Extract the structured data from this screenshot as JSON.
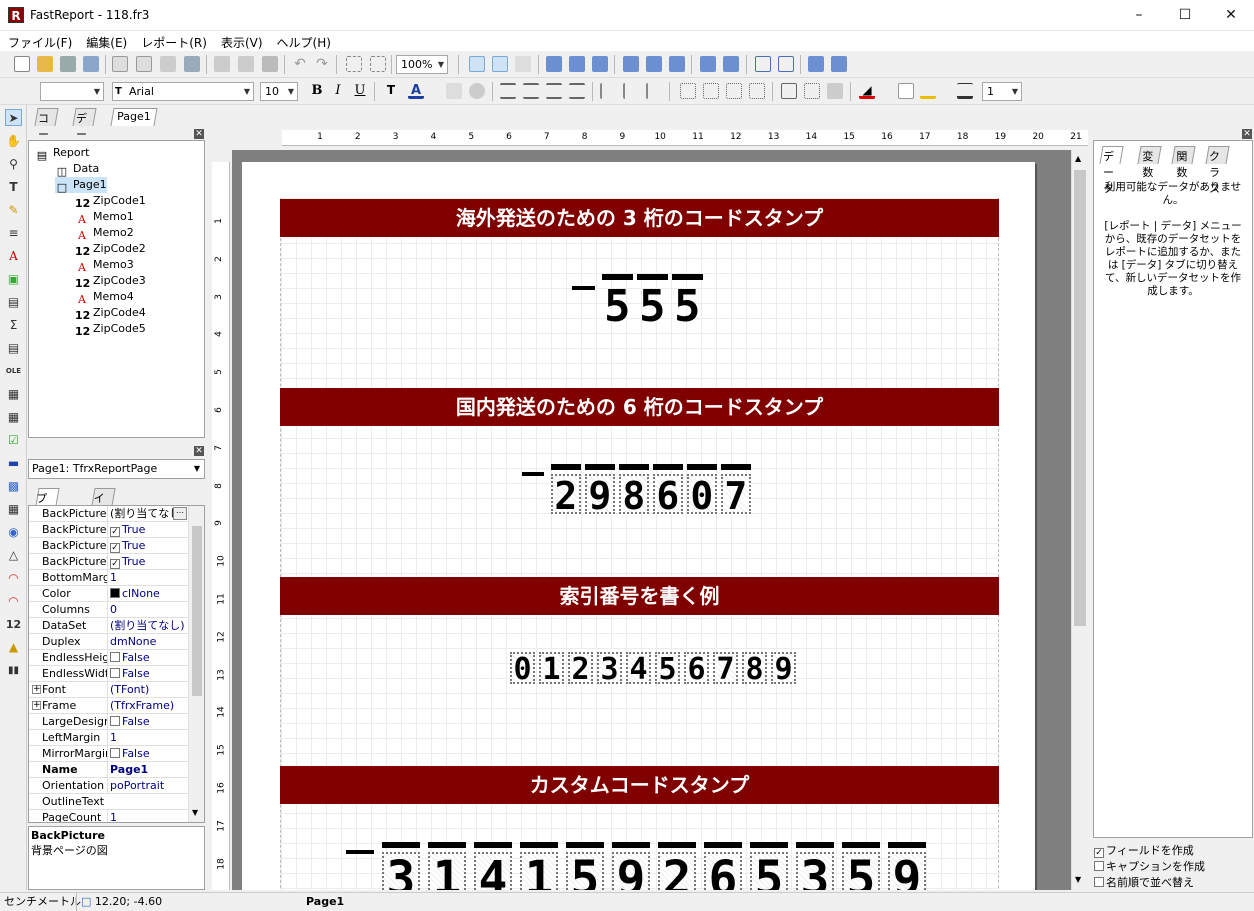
{
  "window": {
    "title": "FastReport - 118.fr3",
    "icon": "R"
  },
  "menu": [
    "ファイル(F)",
    "編集(E)",
    "レポート(R)",
    "表示(V)",
    "ヘルプ(H)"
  ],
  "toolbar": {
    "zoom": "100%",
    "font_name": "Arial",
    "font_size": "10",
    "style_combo": "",
    "line_width": "1"
  },
  "tabs": [
    "コード",
    "データ",
    "Page1"
  ],
  "tree": [
    {
      "label": "Report",
      "level": 0,
      "icon": "report-icon"
    },
    {
      "label": "Data",
      "level": 1,
      "icon": "database-icon"
    },
    {
      "label": "Page1",
      "level": 1,
      "icon": "page-icon"
    },
    {
      "label": "ZipCode1",
      "level": 2,
      "icon": "zipcode-icon"
    },
    {
      "label": "Memo1",
      "level": 2,
      "icon": "text-icon"
    },
    {
      "label": "Memo2",
      "level": 2,
      "icon": "text-icon"
    },
    {
      "label": "ZipCode2",
      "level": 2,
      "icon": "zipcode-icon"
    },
    {
      "label": "Memo3",
      "level": 2,
      "icon": "text-icon"
    },
    {
      "label": "ZipCode3",
      "level": 2,
      "icon": "zipcode-icon"
    },
    {
      "label": "Memo4",
      "level": 2,
      "icon": "text-icon"
    },
    {
      "label": "ZipCode4",
      "level": 2,
      "icon": "zipcode-icon"
    },
    {
      "label": "ZipCode5",
      "level": 2,
      "icon": "zipcode-icon"
    }
  ],
  "object_selector": "Page1: TfrxReportPage",
  "prop_tabs": [
    "プロパティ",
    "イベント"
  ],
  "properties": [
    {
      "name": "BackPicture",
      "value": "(割り当てなし)",
      "type": "text",
      "black": true
    },
    {
      "name": "BackPicturePr",
      "value": "True",
      "type": "check"
    },
    {
      "name": "BackPictureSt",
      "value": "True",
      "type": "check"
    },
    {
      "name": "BackPictureVi",
      "value": "True",
      "type": "check"
    },
    {
      "name": "BottomMargin",
      "value": "1",
      "type": "text"
    },
    {
      "name": "Color",
      "value": "clNone",
      "type": "color"
    },
    {
      "name": "Columns",
      "value": "0",
      "type": "text"
    },
    {
      "name": "DataSet",
      "value": "(割り当てなし)",
      "type": "text"
    },
    {
      "name": "Duplex",
      "value": "dmNone",
      "type": "text"
    },
    {
      "name": "EndlessHeigh",
      "value": "False",
      "type": "uncheck"
    },
    {
      "name": "EndlessWidth",
      "value": "False",
      "type": "uncheck"
    },
    {
      "name": "Font",
      "value": "(TFont)",
      "type": "expand"
    },
    {
      "name": "Frame",
      "value": "(TfrxFrame)",
      "type": "expand"
    },
    {
      "name": "LargeDesignH",
      "value": "False",
      "type": "uncheck"
    },
    {
      "name": "LeftMargin",
      "value": "1",
      "type": "text"
    },
    {
      "name": "MirrorMargins",
      "value": "False",
      "type": "uncheck"
    },
    {
      "name": "Name",
      "value": "Page1",
      "type": "bold"
    },
    {
      "name": "Orientation",
      "value": "poPortrait",
      "type": "text"
    },
    {
      "name": "OutlineText",
      "value": "",
      "type": "text"
    },
    {
      "name": "PageCount",
      "value": "1",
      "type": "text"
    }
  ],
  "description": {
    "title": "BackPicture",
    "text": "背景ページの図"
  },
  "ruler_h": [
    "1",
    "2",
    "3",
    "4",
    "5",
    "6",
    "7",
    "8",
    "9",
    "10",
    "11",
    "12",
    "13",
    "14",
    "15",
    "16",
    "17",
    "18",
    "19",
    "20",
    "21"
  ],
  "ruler_v": [
    "1",
    "2",
    "3",
    "4",
    "5",
    "6",
    "7",
    "8",
    "9",
    "10",
    "11",
    "12",
    "13",
    "14",
    "15",
    "16",
    "17",
    "18"
  ],
  "bands": [
    "海外発送のための 3 桁のコードスタンプ",
    "国内発送のための 6 桁のコードスタンプ",
    "索引番号を書く例",
    "カスタムコードスタンプ"
  ],
  "stamps": [
    {
      "digits": [
        "5",
        "5",
        "5"
      ],
      "boxed": false
    },
    {
      "digits": [
        "2",
        "9",
        "8",
        "6",
        "0",
        "7"
      ],
      "boxed": true
    },
    {
      "digits": [
        "0",
        "1",
        "2",
        "3",
        "4",
        "5",
        "6",
        "7",
        "8",
        "9"
      ],
      "boxed": true
    },
    {
      "digits": [
        "3",
        "1",
        "4",
        "1",
        "5",
        "9",
        "2",
        "6",
        "5",
        "3",
        "5",
        "9"
      ],
      "boxed": true
    }
  ],
  "right_tabs": [
    "データ",
    "変数",
    "関数",
    "クラス"
  ],
  "right_message": "利用可能なデータがありません。\n\n[レポート | データ] メニューから、既存のデータセットをレポートに追加するか、または [データ] タブに切り替えて、新しいデータセットを作成します。",
  "right_options": [
    {
      "label": "フィールドを作成",
      "checked": true
    },
    {
      "label": "キャプションを作成",
      "checked": false
    },
    {
      "label": "名前順で並べ替え",
      "checked": false
    }
  ],
  "status": {
    "unit": "センチメートル",
    "coords": "12.20; -4.60",
    "page": "Page1"
  },
  "colors": {
    "band": "#800000",
    "accent": "#0078d7"
  }
}
